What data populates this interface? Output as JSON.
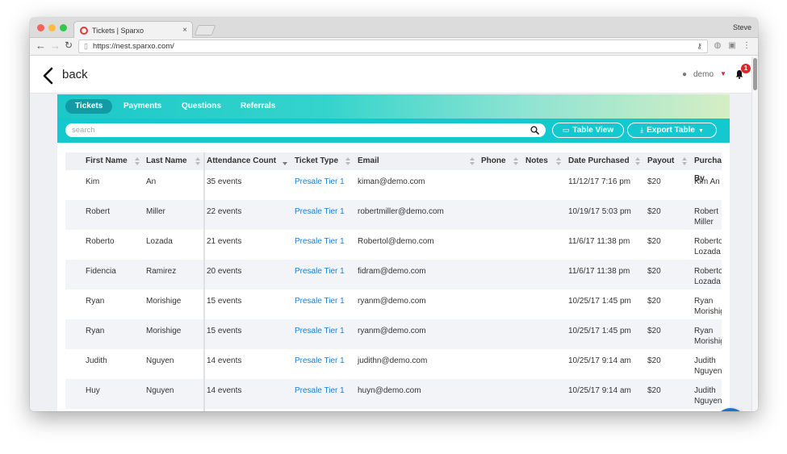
{
  "browser": {
    "tab_title": "Tickets | Sparxo",
    "tab_close": "×",
    "user": "Steve",
    "url": "https://nest.sparxo.com/"
  },
  "header": {
    "back_label": "back",
    "user_label": "demo",
    "notification_count": "1"
  },
  "nav": {
    "tabs": [
      {
        "label": "Tickets",
        "active": true
      },
      {
        "label": "Payments"
      },
      {
        "label": "Questions"
      },
      {
        "label": "Referrals"
      }
    ]
  },
  "toolbar": {
    "search_placeholder": "search",
    "table_view_label": "Table View",
    "export_label": "Export Table"
  },
  "table": {
    "columns": [
      "First Name",
      "Last Name",
      "Attendance Count",
      "Ticket Type",
      "Email",
      "Phone",
      "Notes",
      "Date Purchased",
      "Payout",
      "Purchased By"
    ],
    "rows": [
      {
        "first": "Kim",
        "last": "An",
        "attendance": "35 events",
        "ticket": "Presale Tier 1",
        "email": "kiman@demo.com",
        "phone": "",
        "notes": "",
        "date": "11/12/17 7:16 pm",
        "payout": "$20",
        "purchaser": "Kim An"
      },
      {
        "first": "Robert",
        "last": "Miller",
        "attendance": "22 events",
        "ticket": "Presale Tier 1",
        "email": "robertmiller@demo.com",
        "phone": "",
        "notes": "",
        "date": "10/19/17 5:03 pm",
        "payout": "$20",
        "purchaser": "Robert Miller"
      },
      {
        "first": "Roberto",
        "last": "Lozada",
        "attendance": "21 events",
        "ticket": "Presale Tier 1",
        "email": "Robertol@demo.com",
        "phone": "",
        "notes": "",
        "date": "11/6/17 11:38 pm",
        "payout": "$20",
        "purchaser": "Roberto Lozada"
      },
      {
        "first": "Fidencia",
        "last": "Ramirez",
        "attendance": "20 events",
        "ticket": "Presale Tier 1",
        "email": "fidram@demo.com",
        "phone": "",
        "notes": "",
        "date": "11/6/17 11:38 pm",
        "payout": "$20",
        "purchaser": "Roberto Lozada"
      },
      {
        "first": "Ryan",
        "last": "Morishige",
        "attendance": "15 events",
        "ticket": "Presale Tier 1",
        "email": "ryanm@demo.com",
        "phone": "",
        "notes": "",
        "date": "10/25/17 1:45 pm",
        "payout": "$20",
        "purchaser": "Ryan Morishige"
      },
      {
        "first": "Ryan",
        "last": "Morishige",
        "attendance": "15 events",
        "ticket": "Presale Tier 1",
        "email": "ryanm@demo.com",
        "phone": "",
        "notes": "",
        "date": "10/25/17 1:45 pm",
        "payout": "$20",
        "purchaser": "Ryan Morishige"
      },
      {
        "first": "Judith",
        "last": "Nguyen",
        "attendance": "14 events",
        "ticket": "Presale Tier 1",
        "email": "judithn@demo.com",
        "phone": "",
        "notes": "",
        "date": "10/25/17 9:14 am",
        "payout": "$20",
        "purchaser": "Judith Nguyen"
      },
      {
        "first": "Huy",
        "last": "Nguyen",
        "attendance": "14 events",
        "ticket": "Presale Tier 1",
        "email": "huyn@demo.com",
        "phone": "",
        "notes": "",
        "date": "10/25/17 9:14 am",
        "payout": "$20",
        "purchaser": "Judith Nguyen"
      }
    ]
  },
  "colors": {
    "accent": "#13c9cf",
    "tab_active": "#129ba4",
    "link": "#1a7fd4",
    "badge": "#e3242b",
    "chat": "#1a74c9"
  }
}
